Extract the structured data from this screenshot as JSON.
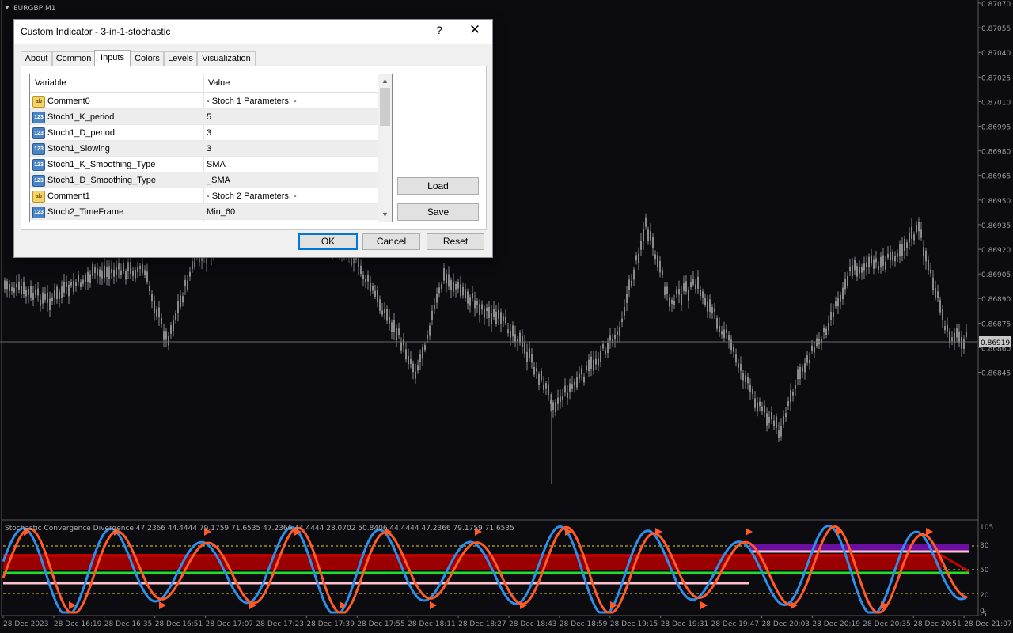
{
  "chart": {
    "symbol_label": "EURGBP,M1",
    "current_price": "0.86919",
    "price_ticks": [
      "0.87070",
      "0.87055",
      "0.87040",
      "0.87025",
      "0.87010",
      "0.86995",
      "0.86980",
      "0.86965",
      "0.86950",
      "0.86935",
      "0.86920",
      "0.86905",
      "0.86890",
      "0.86875",
      "0.86860",
      "0.86845"
    ],
    "indicator_label": "Stochastic Convergence Divergence 47.2366 44.4444 79.1759 71.6535 47.2366 44.4444 28.0702 50.8406 44.4444 47.2366 79.1759 71.6535",
    "indicator_ticks": [
      "105",
      "80",
      "50",
      "20",
      "0",
      "-5"
    ],
    "time_labels": [
      "28 Dec 2023",
      "28 Dec 16:19",
      "28 Dec 16:35",
      "28 Dec 16:51",
      "28 Dec 17:07",
      "28 Dec 17:23",
      "28 Dec 17:39",
      "28 Dec 17:55",
      "28 Dec 18:11",
      "28 Dec 18:27",
      "28 Dec 18:43",
      "28 Dec 18:59",
      "28 Dec 19:15",
      "28 Dec 19:31",
      "28 Dec 19:47",
      "28 Dec 20:03",
      "28 Dec 20:19",
      "28 Dec 20:35",
      "28 Dec 20:51",
      "28 Dec 21:07"
    ],
    "colors": {
      "background": "#0b0b10",
      "candles": "#8a8a8a",
      "k_line": "#2f8ee8",
      "d_line": "#ff5a28",
      "band_upper": "#7a0000",
      "band_fill": "#9a0000",
      "mid_line": "#22dd22",
      "low_line": "#ffc0cb",
      "top_band": "#6a0fa0"
    }
  },
  "dialog": {
    "title": "Custom Indicator - 3-in-1-stochastic",
    "help_glyph": "?",
    "close_glyph": "✕",
    "tabs": [
      {
        "label": "About"
      },
      {
        "label": "Common"
      },
      {
        "label": "Inputs"
      },
      {
        "label": "Colors"
      },
      {
        "label": "Levels"
      },
      {
        "label": "Visualization"
      }
    ],
    "active_tab": "Inputs",
    "table": {
      "col_variable": "Variable",
      "col_value": "Value",
      "rows": [
        {
          "icon": "ab",
          "variable": "Comment0",
          "value": "- Stoch 1 Parameters: -"
        },
        {
          "icon": "123",
          "variable": "Stoch1_K_period",
          "value": "5"
        },
        {
          "icon": "123",
          "variable": "Stoch1_D_period",
          "value": "3"
        },
        {
          "icon": "123",
          "variable": "Stoch1_Slowing",
          "value": "3"
        },
        {
          "icon": "123",
          "variable": "Stoch1_K_Smoothing_Type",
          "value": "SMA"
        },
        {
          "icon": "123",
          "variable": "Stoch1_D_Smoothing_Type",
          "value": "_SMA"
        },
        {
          "icon": "ab",
          "variable": "Comment1",
          "value": "- Stoch 2 Parameters: -"
        },
        {
          "icon": "123",
          "variable": "Stoch2_TimeFrame",
          "value": "Min_60"
        }
      ]
    },
    "load_label": "Load",
    "save_label": "Save",
    "ok_label": "OK",
    "cancel_label": "Cancel",
    "reset_label": "Reset"
  }
}
